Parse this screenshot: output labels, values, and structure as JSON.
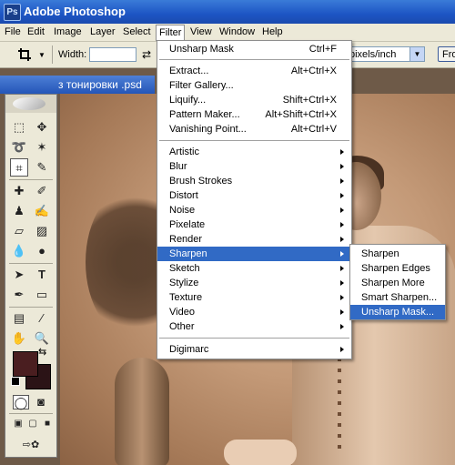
{
  "app": {
    "title": "Adobe Photoshop",
    "icon": "photoshop-logo-icon"
  },
  "menubar": {
    "items": [
      "File",
      "Edit",
      "Image",
      "Layer",
      "Select",
      "Filter",
      "View",
      "Window",
      "Help"
    ],
    "active": "Filter"
  },
  "options_bar": {
    "tool_icon": "crop-icon",
    "width_label": "Width:",
    "width_value": "",
    "resolution_unit": "pixels/inch",
    "front_button": "Fro"
  },
  "document": {
    "title_fragment": "з тонировки .psd"
  },
  "filter_menu": {
    "top": {
      "label": "Unsharp Mask",
      "shortcut": "Ctrl+F"
    },
    "group1": [
      {
        "label": "Extract...",
        "shortcut": "Alt+Ctrl+X"
      },
      {
        "label": "Filter Gallery...",
        "shortcut": ""
      },
      {
        "label": "Liquify...",
        "shortcut": "Shift+Ctrl+X"
      },
      {
        "label": "Pattern Maker...",
        "shortcut": "Alt+Shift+Ctrl+X"
      },
      {
        "label": "Vanishing Point...",
        "shortcut": "Alt+Ctrl+V"
      }
    ],
    "group2": [
      "Artistic",
      "Blur",
      "Brush Strokes",
      "Distort",
      "Noise",
      "Pixelate",
      "Render",
      "Sharpen",
      "Sketch",
      "Stylize",
      "Texture",
      "Video",
      "Other"
    ],
    "highlighted": "Sharpen",
    "group3": [
      "Digimarc"
    ]
  },
  "sharpen_submenu": {
    "items": [
      "Sharpen",
      "Sharpen Edges",
      "Sharpen More",
      "Smart Sharpen...",
      "Unsharp Mask..."
    ],
    "highlighted": "Unsharp Mask..."
  },
  "colors": {
    "titlebar": "#1d55c4",
    "highlight": "#316ac5",
    "foreground_swatch": "#4a1e20",
    "background_swatch": "#2b1316"
  }
}
